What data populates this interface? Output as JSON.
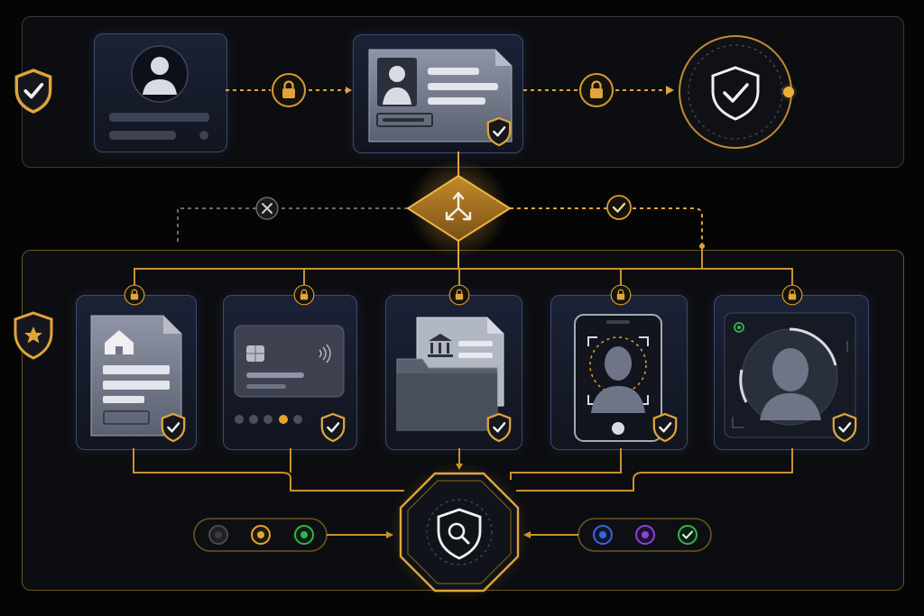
{
  "colors": {
    "background": "#050505",
    "panel_border": "#3a3a3a",
    "gold": "#e0a43a",
    "gold_dim": "#8a6a2a",
    "node_border": "#3c4a6e",
    "status_dark": "#3b3b3b",
    "status_yellow": "#e3a72f",
    "status_green": "#35b34a",
    "status_blue": "#3a66d8",
    "status_purple": "#8a44d6"
  },
  "top_flow": {
    "nodes": [
      {
        "id": "user-profile",
        "icon": "user-avatar-icon"
      },
      {
        "id": "id-card",
        "icon": "id-card-icon",
        "badge": "shield-check-icon"
      },
      {
        "id": "verified",
        "icon": "shield-check-icon"
      }
    ],
    "connectors": [
      "lock-icon",
      "lock-icon"
    ],
    "side_icon": "shield-check-icon"
  },
  "router": {
    "icon": "branch-icon",
    "reject_icon": "close-icon",
    "accept_icon": "check-icon"
  },
  "bottom_flow": {
    "side_icon": "shield-star-icon",
    "nodes": [
      {
        "id": "address-document",
        "icon": "house-document-icon",
        "badge": "shield-check-icon"
      },
      {
        "id": "payment-card",
        "icon": "credit-card-icon",
        "badge": "shield-check-icon"
      },
      {
        "id": "bank-folder",
        "icon": "bank-folder-icon",
        "badge": "shield-check-icon"
      },
      {
        "id": "phone-face-scan",
        "icon": "phone-face-scan-icon",
        "badge": "shield-check-icon"
      },
      {
        "id": "face-recognition",
        "icon": "face-scan-icon",
        "badge": "shield-check-icon"
      }
    ],
    "hub_icon": "shield-search-icon",
    "left_status": [
      "dark",
      "yellow",
      "green"
    ],
    "right_status": [
      "blue",
      "purple",
      "check"
    ]
  }
}
